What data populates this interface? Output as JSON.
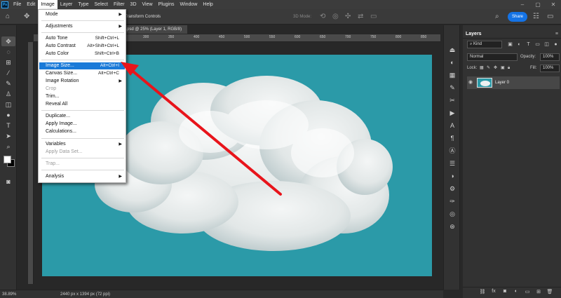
{
  "menubar": {
    "logo": "Ps",
    "items": [
      "File",
      "Edit",
      "Image",
      "Layer",
      "Type",
      "Select",
      "Filter",
      "3D",
      "View",
      "Plugins",
      "Window",
      "Help"
    ],
    "window_controls": [
      "–",
      "▢",
      "✕"
    ]
  },
  "options_bar": {
    "transform_controls": "Transform Controls",
    "mode_3d": "3D Mode:",
    "share": "Share"
  },
  "document": {
    "tab_title": "image.psd @ 25% (Layer 1, RGB/8)",
    "ruler_labels": [
      "100",
      "150",
      "200",
      "250",
      "300",
      "350",
      "400",
      "450",
      "500",
      "550",
      "600",
      "650",
      "700",
      "750",
      "800",
      "850"
    ],
    "zoom": "38.89%",
    "dimensions": "2440 px x 1394 px (72 ppi)"
  },
  "image_menu": {
    "items": [
      {
        "label": "Mode",
        "submenu": true
      },
      {
        "label": "Adjustments",
        "submenu": true
      },
      {
        "label": "Auto Tone",
        "shortcut": "Shift+Ctrl+L"
      },
      {
        "label": "Auto Contrast",
        "shortcut": "Alt+Shift+Ctrl+L"
      },
      {
        "label": "Auto Color",
        "shortcut": "Shift+Ctrl+B"
      },
      {
        "label": "Image Size...",
        "shortcut": "Alt+Ctrl+I",
        "highlighted": true
      },
      {
        "label": "Canvas Size...",
        "shortcut": "Alt+Ctrl+C"
      },
      {
        "label": "Image Rotation",
        "submenu": true
      },
      {
        "label": "Crop",
        "disabled": true
      },
      {
        "label": "Trim..."
      },
      {
        "label": "Reveal All"
      },
      {
        "label": "Duplicate..."
      },
      {
        "label": "Apply Image..."
      },
      {
        "label": "Calculations..."
      },
      {
        "label": "Variables",
        "submenu": true
      },
      {
        "label": "Apply Data Set...",
        "disabled": true
      },
      {
        "label": "Trap...",
        "disabled": true
      },
      {
        "label": "Analysis",
        "submenu": true
      }
    ]
  },
  "layers_panel": {
    "tab": "Layers",
    "filter_kind": "Kind",
    "blend_mode": "Normal",
    "opacity_label": "Opacity:",
    "opacity_value": "100%",
    "lock_label": "Lock:",
    "fill_label": "Fill:",
    "fill_value": "100%",
    "layers": [
      {
        "name": "Layer 0",
        "visible": true
      }
    ]
  },
  "colors": {
    "canvas": "#2b9aa8",
    "highlight": "#1a7ad8",
    "arrow": "#e8141b",
    "share": "#1473e6"
  }
}
